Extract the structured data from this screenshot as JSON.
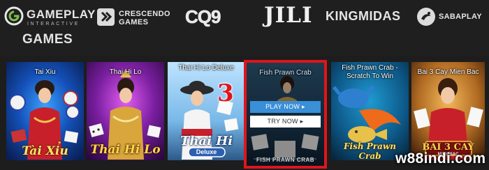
{
  "providers": {
    "gameplay": {
      "name": "GAMEPLAY",
      "sub": "INTERACTIVE",
      "icon": "gameplay-logo-icon"
    },
    "crescendo": {
      "line1": "CRESCENDO",
      "line2": "GAMES",
      "icon": "crescendo-logo-icon"
    },
    "cq9": {
      "name": "CQ9"
    },
    "jili": {
      "name": "JILI"
    },
    "kingmidas": {
      "name": "KINGMIDAS"
    },
    "saba": {
      "name": "SABAPLAY",
      "icon": "sabaplay-logo-icon"
    },
    "games": {
      "name": "GAMES"
    }
  },
  "games": [
    {
      "title": "Tai Xiu",
      "logo": "Tài Xỉu"
    },
    {
      "title": "Thai Hi Lo",
      "logo": "Thai Hi Lo"
    },
    {
      "title": "Thai Hi Lo Deluxe",
      "logo": "Thai Hi",
      "badge": "Deluxe"
    },
    {
      "title": "Fish Prawn Crab",
      "play": "PLAY NOW",
      "try": "TRY NOW",
      "logo": "FISH PRAWN CRAB"
    },
    {
      "title": "Fish Prawn Crab - Scratch To Win",
      "logo": "Fish Prawn Crab"
    },
    {
      "title": "Bai 3 Cay Mien Bac",
      "logo": "BAI 3 CAY",
      "sub": "MIEN BAC"
    }
  ],
  "annotation_number": "3",
  "watermark": "w88indi.com",
  "colors": {
    "highlight": "#e0151b",
    "play_button": "#3a8fd6",
    "background": "#1d1d1d"
  }
}
